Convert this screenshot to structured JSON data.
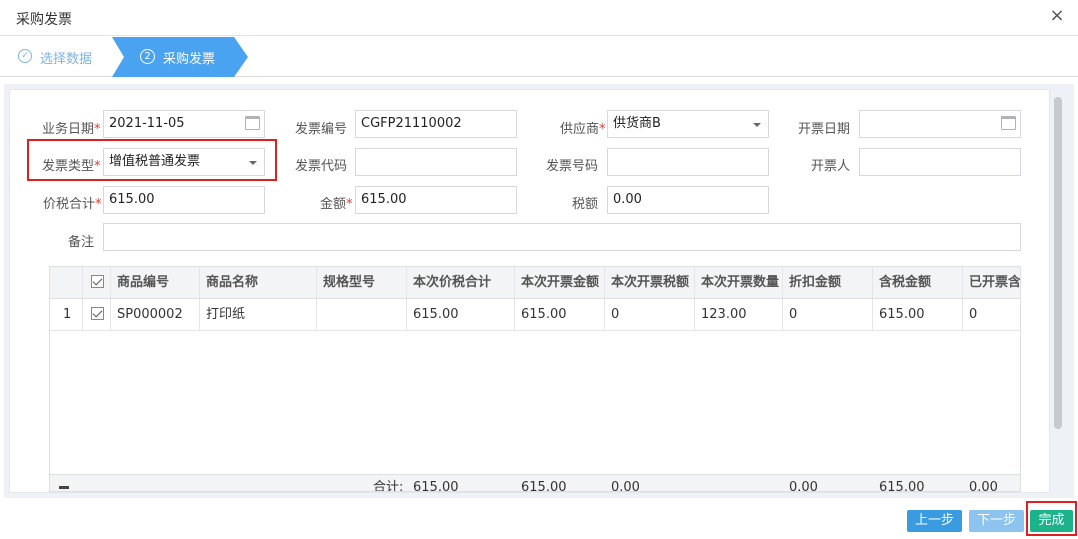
{
  "window": {
    "title": "采购发票",
    "close_glyph": "×"
  },
  "steps": [
    {
      "label": "选择数据",
      "icon": "check-circle-icon",
      "glyph": "✓"
    },
    {
      "label": "采购发票",
      "icon": "circled-2-icon",
      "glyph": "2"
    }
  ],
  "form": {
    "biz_date_label": "业务日期",
    "biz_date_value": "2021-11-05",
    "invoice_no_label": "发票编号",
    "invoice_no_value": "CGFP21110002",
    "supplier_label": "供应商",
    "supplier_value": "供货商B",
    "issue_date_label": "开票日期",
    "issue_date_value": "",
    "invoice_type_label": "发票类型",
    "invoice_type_value": "增值税普通发票",
    "invoice_code_label": "发票代码",
    "invoice_code_value": "",
    "invoice_number_label": "发票号码",
    "invoice_number_value": "",
    "issuer_label": "开票人",
    "issuer_value": "",
    "total_label": "价税合计",
    "total_value": "615.00",
    "amount_label": "金额",
    "amount_value": "615.00",
    "tax_label": "税额",
    "tax_value": "0.00",
    "remark_label": "备注",
    "remark_value": "",
    "required_mark": "*"
  },
  "table": {
    "headers": [
      "商品编号",
      "商品名称",
      "规格型号",
      "本次价税合计",
      "本次开票金额",
      "本次开票税额",
      "本次开票数量",
      "折扣金额",
      "含税金额",
      "已开票含"
    ],
    "rows": [
      {
        "index": "1",
        "checked": true,
        "cells": [
          "SP000002",
          "打印纸",
          "",
          "615.00",
          "615.00",
          "0",
          "123.00",
          "0",
          "615.00",
          "0"
        ]
      }
    ],
    "footer": {
      "label": "合计:",
      "cells": [
        "615.00",
        "615.00",
        "0.00",
        "",
        "0.00",
        "615.00",
        "0.00"
      ]
    }
  },
  "buttons": {
    "prev": "上一步",
    "next": "下一步",
    "done": "完成"
  },
  "colors": {
    "accent": "#3a9be0",
    "step_active": "#4aa3f0",
    "done": "#1cb38b",
    "required": "#e53935",
    "highlight": "#e02020"
  }
}
